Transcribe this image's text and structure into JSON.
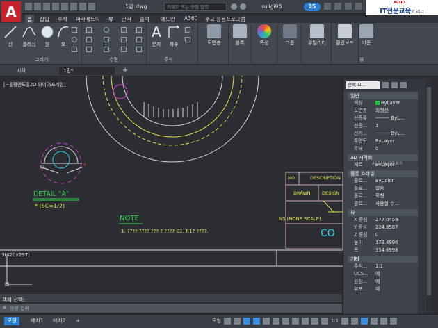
{
  "app": {
    "logo_letter": "A",
    "document_title": "1강.dwg",
    "search_placeholder": "키워드 또는 구절 입력",
    "username": "sullgi90",
    "clock_count": "25"
  },
  "watermark": {
    "brand_small": "ALZIO",
    "brand": "IT전문교육",
    "suffix": "의 리더"
  },
  "ribbon_tabs": [
    "홈",
    "삽입",
    "주석",
    "파라메트릭",
    "뷰",
    "관리",
    "출력",
    "애드인",
    "A360",
    "주요 응용프로그램"
  ],
  "ribbon": {
    "draw": {
      "line": "선",
      "polyline": "폴리선",
      "circle": "원",
      "arc": "호",
      "panel": "그리기"
    },
    "modify": {
      "panel": "수정"
    },
    "annotation": {
      "text": "문자",
      "dimension": "치수",
      "panel": "주석"
    },
    "layers": "도면층",
    "block": "블록",
    "properties": "특성",
    "groups": "그룹",
    "utilities": "유틸리티",
    "clipboard": "클립보드",
    "view_base": "기준",
    "view_panel": "뷰"
  },
  "doc_tabs": {
    "start": "시작",
    "current": "1강*"
  },
  "viewport_label": "[−][평면도][2D 와이어프레임]",
  "drawing": {
    "detail_letter": "6",
    "detail_title": "DETAIL \"A\"",
    "detail_scale": "* (SC=1/2)",
    "note_title": "NOTE",
    "note_text": "1. ???? ???? ??? ? ???? C1, R1? ????.",
    "table_col_no": "NO.",
    "table_col_desc": "DESCRIPTION",
    "table_drawn": "DRAWN",
    "table_design": "DESIGN",
    "table_scale": "NS (NONE SCALE)",
    "table_co": "CO",
    "paper_size": "3(420x297)"
  },
  "properties": {
    "selection": "선택 요...",
    "general_header": "일반",
    "general": [
      {
        "key": "색상",
        "value": "ByLayer",
        "swatch": "#24c43b"
      },
      {
        "key": "도면층",
        "value": "외형선"
      },
      {
        "key": "선종류",
        "value": "——— ByL..."
      },
      {
        "key": "선종...",
        "value": "1"
      },
      {
        "key": "선가...",
        "value": "——— ByL..."
      },
      {
        "key": "투명도",
        "value": "ByLayer"
      },
      {
        "key": "두께",
        "value": "0"
      }
    ],
    "viz_header": "3D 시각화",
    "viz": [
      {
        "key": "재료",
        "value": "ByLayer"
      }
    ],
    "plot_header": "플롯 스타일",
    "plot": [
      {
        "key": "플로...",
        "value": "ByColor"
      },
      {
        "key": "플로...",
        "value": "없음"
      },
      {
        "key": "플로...",
        "value": "모형"
      },
      {
        "key": "플로...",
        "value": "사용할 수..."
      }
    ],
    "view_header": "뷰",
    "view": [
      {
        "key": "X 중심",
        "value": "277.0459"
      },
      {
        "key": "Y 중심",
        "value": "224.8587"
      },
      {
        "key": "Z 중심",
        "value": "0"
      },
      {
        "key": "높이",
        "value": "179.4996"
      },
      {
        "key": "폭",
        "value": "354.6998"
      }
    ],
    "misc_header": "기타",
    "misc": [
      {
        "key": "주석...",
        "value": "1:1"
      },
      {
        "key": "UCS...",
        "value": "예"
      },
      {
        "key": "원점...",
        "value": "예"
      },
      {
        "key": "뷰포...",
        "value": "예"
      }
    ],
    "watermark": "ALZIO.CO.KR"
  },
  "command": {
    "history": "객체 선택:",
    "prompt": "명령 입력"
  },
  "status": {
    "model": "모형",
    "layout1": "배치1",
    "layout2": "배치2",
    "grid_label": "모형",
    "scale": "1:1"
  },
  "colors": {
    "canvas": "#2b2d33",
    "accent": "#2a7fd5",
    "yellow_line": "#e3e34a",
    "green_text": "#2fd84a",
    "magenta": "#c93bc9",
    "cyan": "#30d2e8",
    "title_block": "#c8a9b4"
  }
}
